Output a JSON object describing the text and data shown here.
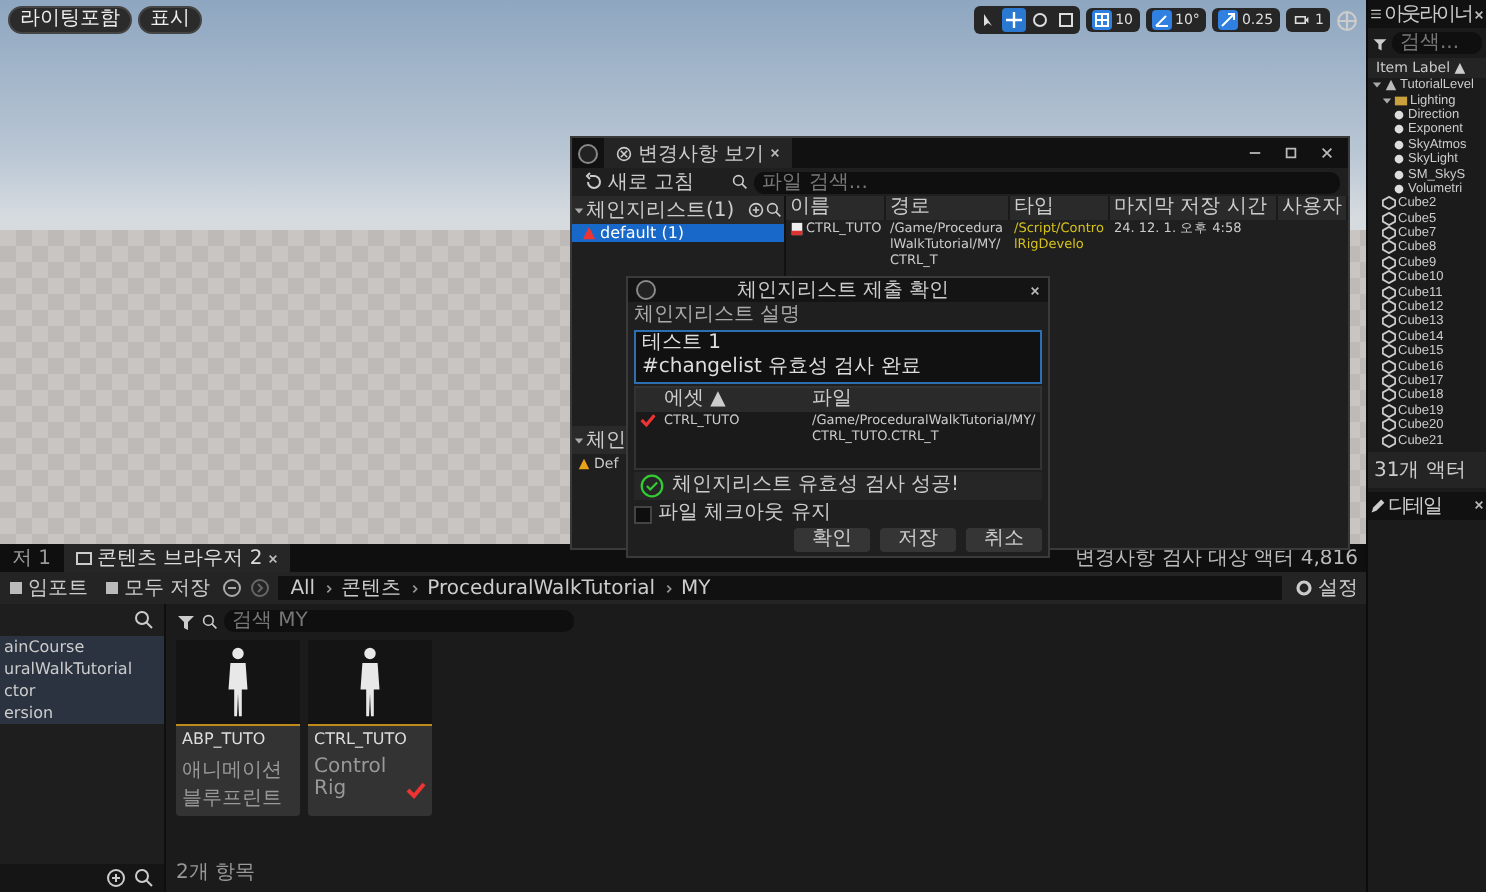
{
  "viewport": {
    "view_buttons": [
      "라이팅포함",
      "표시"
    ],
    "tools": [
      {
        "kind": "select",
        "selected": false
      },
      {
        "kind": "move",
        "selected": true
      },
      {
        "kind": "rotate",
        "selected": false
      },
      {
        "kind": "scale",
        "selected": false
      }
    ],
    "snaps": [
      {
        "kind": "grid",
        "value": "10",
        "on": true
      },
      {
        "kind": "rotate",
        "value": "10°",
        "on": true
      },
      {
        "kind": "scale",
        "value": "0.25",
        "on": true
      }
    ],
    "camera_speed": "1"
  },
  "outliner": {
    "title": "아웃라이너",
    "search": {
      "placeholder": "검색..."
    },
    "column": "Item Label ▲",
    "tree": [
      {
        "label": "TutorialLevel",
        "kind": "level",
        "expanded": true,
        "children": [
          {
            "label": "Lighting",
            "kind": "folder",
            "expanded": true,
            "children": [
              {
                "label": "Direction",
                "kind": "light"
              },
              {
                "label": "Exponent",
                "kind": "light"
              },
              {
                "label": "SkyAtmos",
                "kind": "light"
              },
              {
                "label": "SkyLight",
                "kind": "light"
              },
              {
                "label": "SM_SkyS",
                "kind": "light"
              },
              {
                "label": "Volumetri",
                "kind": "light"
              }
            ]
          },
          {
            "label": "Cube2",
            "kind": "actor"
          },
          {
            "label": "Cube5",
            "kind": "actor"
          },
          {
            "label": "Cube7",
            "kind": "actor"
          },
          {
            "label": "Cube8",
            "kind": "actor"
          },
          {
            "label": "Cube9",
            "kind": "actor"
          },
          {
            "label": "Cube10",
            "kind": "actor"
          },
          {
            "label": "Cube11",
            "kind": "actor"
          },
          {
            "label": "Cube12",
            "kind": "actor"
          },
          {
            "label": "Cube13",
            "kind": "actor"
          },
          {
            "label": "Cube14",
            "kind": "actor"
          },
          {
            "label": "Cube15",
            "kind": "actor"
          },
          {
            "label": "Cube16",
            "kind": "actor"
          },
          {
            "label": "Cube17",
            "kind": "actor"
          },
          {
            "label": "Cube18",
            "kind": "actor"
          },
          {
            "label": "Cube19",
            "kind": "actor"
          },
          {
            "label": "Cube20",
            "kind": "actor"
          },
          {
            "label": "Cube21",
            "kind": "actor"
          }
        ]
      }
    ],
    "count": "31개 액터"
  },
  "details": {
    "title": "디테일"
  },
  "changes_window": {
    "tab": "변경사항 보기",
    "refresh": "새로 고침",
    "search": {
      "placeholder": "파일 검색..."
    },
    "changelists_header": "체인지리스트(1)",
    "changelists": [
      {
        "label": "default (1)",
        "selected": true
      }
    ],
    "columns": [
      "이름",
      "경로",
      "타입",
      "마지막 저장 시간",
      "사용자"
    ],
    "rows": [
      {
        "name": "CTRL_TUTO",
        "path": "/Game/ProceduralWalkTutorial/MY/CTRL_T",
        "type": "/Script/ControlRigDevelo",
        "saved": "24. 12. 1. 오후 4:58"
      }
    ],
    "lower_header": "체인",
    "lower_items": [
      "Def"
    ]
  },
  "submit_dialog": {
    "title": "체인지리스트 제출 확인",
    "description_label": "체인지리스트 설명",
    "description": "테스트 1\n#changelist 유효성 검사 완료",
    "columns": [
      "에셋 ▲",
      "파일"
    ],
    "rows": [
      {
        "checked": true,
        "asset": "CTRL_TUTO",
        "file": "/Game/ProceduralWalkTutorial/MY/CTRL_TUTO.CTRL_T"
      }
    ],
    "validation": "체인지리스트 유효성 검사 성공!",
    "keep_checked_out": {
      "label": "파일 체크아웃 유지",
      "checked": false
    },
    "buttons": [
      "확인",
      "저장",
      "취소"
    ]
  },
  "content_browser": {
    "tabs": [
      {
        "label": "저 1",
        "selected": false
      },
      {
        "label": "콘텐츠 브라우저 2",
        "selected": true
      }
    ],
    "status": "변경사항 검사 대상 액터 4,816",
    "toolbar": [
      "임포트",
      "모두 저장"
    ],
    "breadcrumb": [
      "All",
      "콘텐츠",
      "ProceduralWalkTutorial",
      "MY"
    ],
    "settings": "설정",
    "tree": [
      {
        "label": "ainCourse",
        "selected": false
      },
      {
        "label": "uralWalkTutorial",
        "selected": false
      },
      {
        "label": "ctor",
        "selected": false
      },
      {
        "label": "ersion",
        "selected": false
      }
    ],
    "search": {
      "placeholder": "검색 MY"
    },
    "assets": [
      {
        "name": "ABP_TUTO",
        "type": "애니메이션 블루프린트",
        "checked": false
      },
      {
        "name": "CTRL_TUTO",
        "type": "Control Rig",
        "checked": true
      }
    ],
    "count": "2개 항목"
  }
}
